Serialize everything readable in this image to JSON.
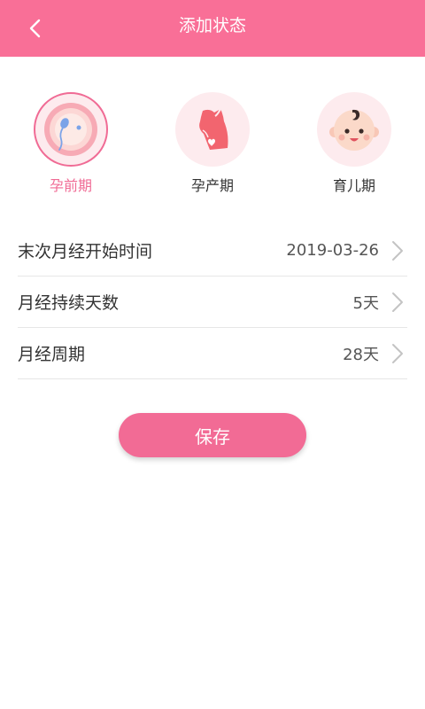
{
  "header": {
    "title": "添加状态",
    "back_icon": "chevron-left-icon"
  },
  "stages": [
    {
      "label": "孕前期",
      "icon": "egg-sperm-icon",
      "selected": true
    },
    {
      "label": "孕产期",
      "icon": "pregnant-belly-icon",
      "selected": false
    },
    {
      "label": "育儿期",
      "icon": "baby-face-icon",
      "selected": false
    }
  ],
  "form": {
    "rows": [
      {
        "label": "末次月经开始时间",
        "value": "2019-03-26"
      },
      {
        "label": "月经持续天数",
        "value": "5天"
      },
      {
        "label": "月经周期",
        "value": "28天"
      }
    ]
  },
  "save_label": "保存",
  "colors": {
    "primary": "#f96f97",
    "accent": "#f06b95",
    "circle_bg": "#fdebee"
  }
}
